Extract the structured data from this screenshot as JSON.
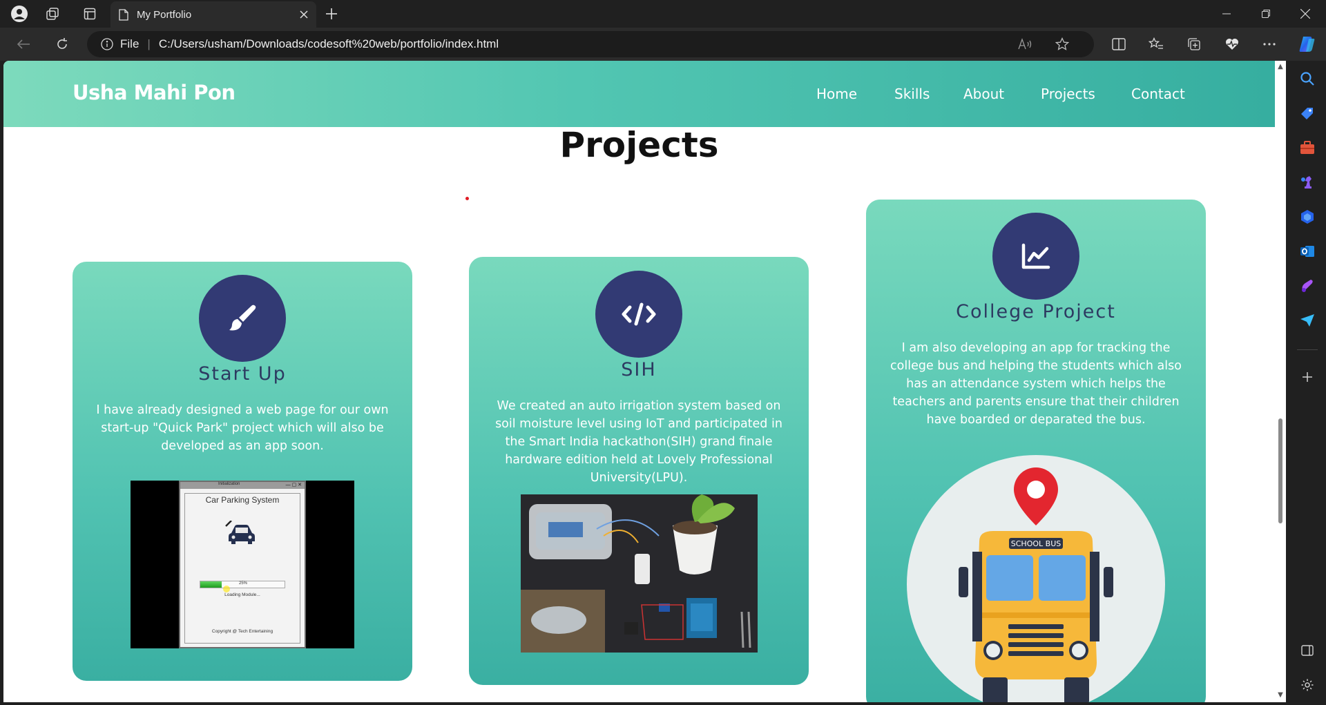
{
  "browser": {
    "tab_title": "My Portfolio",
    "address_scheme_label": "File",
    "url": "C:/Users/usham/Downloads/codesoft%20web/portfolio/index.html"
  },
  "header": {
    "logo": "Usha Mahi Pon",
    "nav": [
      "Home",
      "Skills",
      "About",
      "Projects",
      "Contact"
    ]
  },
  "section": {
    "title": "Projects"
  },
  "cards": [
    {
      "icon": "paintbrush-icon",
      "title": "Start Up",
      "description": "I have already designed a web page for our own start-up \"Quick Park\" project which will also be developed as an app soon.",
      "screenshot": {
        "window_title": "Initialization",
        "heading": "Car Parking System",
        "progress_label": "25%",
        "progress": 0.25,
        "status": "Loading Module...",
        "footer": "Copyright @ Tech Entertaining"
      }
    },
    {
      "icon": "code-icon",
      "title": "SIH",
      "description": "We created an auto irrigation system based on soil moisture level using IoT and participated in the Smart India hackathon(SIH) grand finale hardware edition held at Lovely Professional University(LPU)."
    },
    {
      "icon": "chart-line-icon",
      "title": "College Project",
      "description": "I am also developing an app for tracking the college bus and helping the students which also has an attendance system which helps the teachers and parents ensure that their children have boarded or deparated the bus.",
      "bus_sign": "SCHOOL BUS"
    }
  ],
  "colors": {
    "header_start": "#7ddabc",
    "header_end": "#36aea0",
    "icon_circle": "#323a74",
    "card_title": "#2d3a61"
  }
}
